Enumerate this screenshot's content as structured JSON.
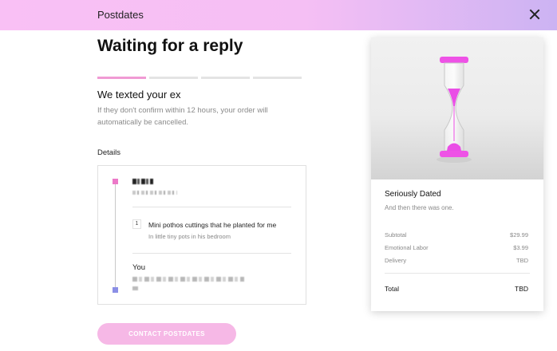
{
  "header": {
    "brand": "Postdates",
    "close_icon": "close-icon"
  },
  "main": {
    "title": "Waiting for a reply",
    "progress": {
      "total_steps": 4,
      "current_step": 1
    },
    "status_title": "We texted your ex",
    "status_description": "If they don't confirm within 12 hours, your order will automatically be cancelled.",
    "details_label": "Details",
    "details": {
      "item": {
        "quantity": "1",
        "name": "Mini pothos cuttings that he planted for me",
        "note": "In little tiny pots in his bedroom"
      },
      "you_label": "You"
    },
    "cta_label": "CONTACT POSTDATES"
  },
  "summary": {
    "product_title": "Seriously Dated",
    "product_subtitle": "And then there was one.",
    "rows": [
      {
        "label": "Subtotal",
        "value": "$29.99"
      },
      {
        "label": "Emotional Labor",
        "value": "$3.99"
      },
      {
        "label": "Delivery",
        "value": "TBD"
      }
    ],
    "total": {
      "label": "Total",
      "value": "TBD"
    }
  },
  "colors": {
    "header_gradient_start": "#f9c0f5",
    "header_gradient_end": "#ccb3f3",
    "accent_pink": "#f09ad4",
    "timeline_start": "#ec79c8",
    "timeline_end": "#8b8fe6",
    "button_bg": "#f6b8e6",
    "hourglass_sand": "#e64de8"
  }
}
